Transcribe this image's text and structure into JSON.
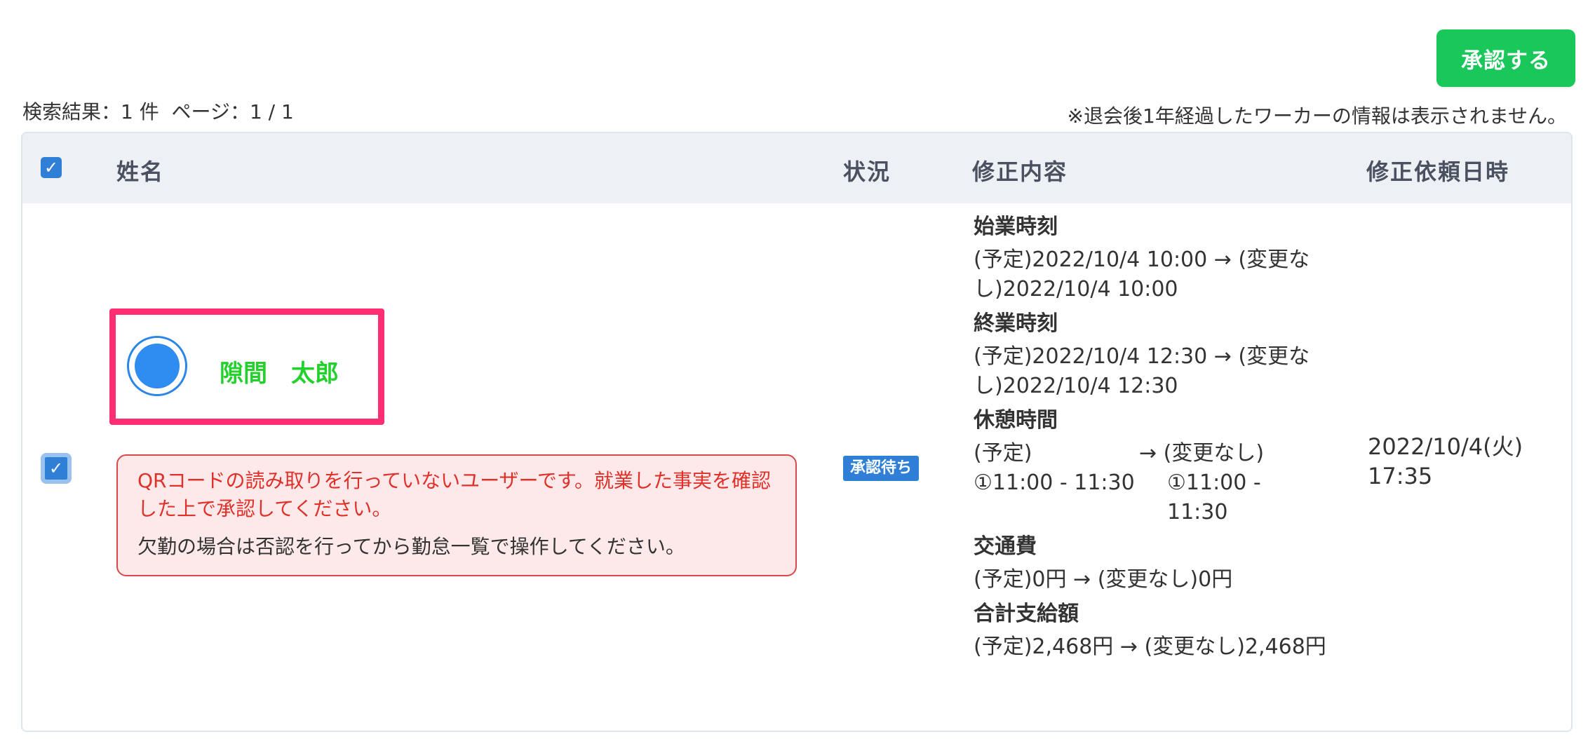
{
  "toolbar": {
    "approve_label": "承認する"
  },
  "summary": {
    "result_text": "検索結果：1 件  ページ：1 / 1",
    "retention_note": "※退会後1年経過したワーカーの情報は表示されません。"
  },
  "table": {
    "headers": {
      "name": "姓名",
      "status": "状況",
      "changes": "修正内容",
      "requested_at": "修正依頼日時"
    },
    "select_all_checked": true,
    "rows": [
      {
        "checked": true,
        "worker_name": "隙間　太郎",
        "warning_main": "QRコードの読み取りを行っていないユーザーです。就業した事実を確認した上で承認してください。",
        "warning_sub": "欠勤の場合は否認を行ってから勤怠一覧で操作してください。",
        "status": "承認待ち",
        "changes": {
          "start_label": "始業時刻",
          "start_value": "(予定)2022/10/4 10:00 → (変更なし)2022/10/4 10:00",
          "end_label": "終業時刻",
          "end_value": "(予定)2022/10/4 12:30 → (変更なし)2022/10/4 12:30",
          "break_label": "休憩時間",
          "break_planned_prefix": "(予定)",
          "break_planned_value": "①11:00 - 11:30",
          "break_changed_prefix": "→ (変更なし)",
          "break_changed_value": "①11:00 - 11:30",
          "transport_label": "交通費",
          "transport_value": "(予定)0円 → (変更なし)0円",
          "total_label": "合計支給額",
          "total_value": "(予定)2,468円 → (変更なし)2,468円"
        },
        "requested_at": "2022/10/4(火) 17:35"
      }
    ]
  },
  "colors": {
    "approve_button": "#19c75a",
    "highlight_border": "#ff2d72",
    "worker_name": "#22d12b",
    "warning_text": "#e0302a",
    "warning_bg": "#fde9e9",
    "status_badge": "#2f7fd6",
    "checkbox": "#2f7fd6"
  },
  "icons": {
    "check": "check-icon",
    "avatar": "avatar-circle-icon"
  }
}
